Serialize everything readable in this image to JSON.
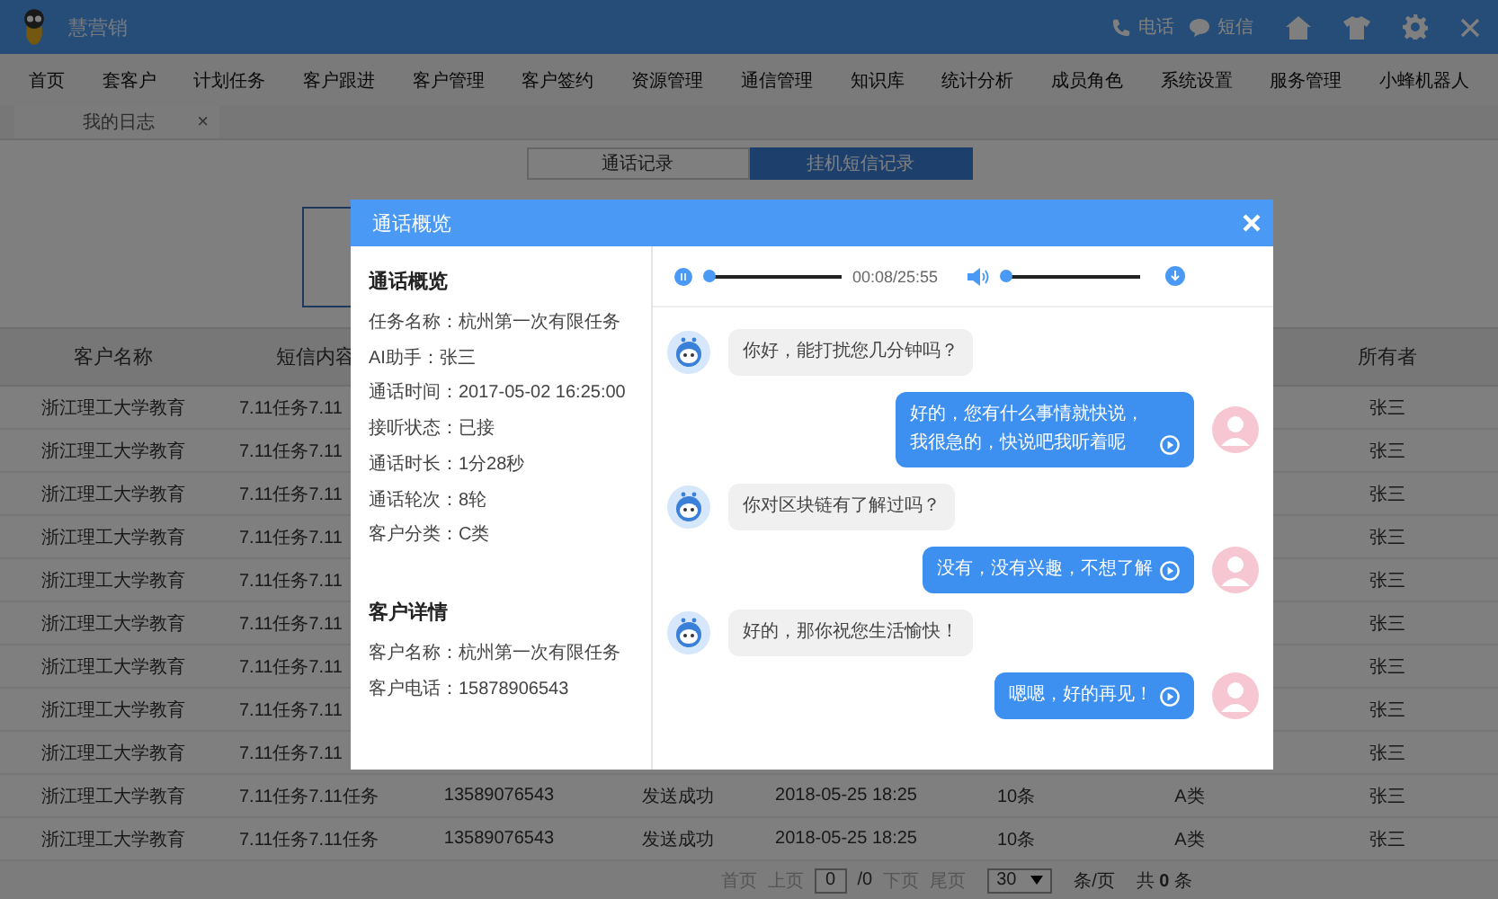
{
  "app": {
    "title": "慧营销",
    "actions": [
      {
        "kind": "phone",
        "label": "电话"
      },
      {
        "kind": "sms",
        "label": "短信"
      }
    ]
  },
  "nav": {
    "items": [
      "首页",
      "套客户",
      "计划任务",
      "客户跟进",
      "客户管理",
      "客户签约",
      "资源管理",
      "通信管理",
      "知识库",
      "统计分析",
      "成员角色",
      "系统设置",
      "服务管理",
      "小蜂机器人"
    ]
  },
  "page_tabs": [
    {
      "label": "我的日志",
      "close": "×"
    }
  ],
  "record_tabs": [
    {
      "label": "通话记录",
      "selected": false
    },
    {
      "label": "挂机短信记录",
      "selected": true
    }
  ],
  "table": {
    "columns": [
      "客户名称",
      "短信内容",
      null,
      null,
      null,
      null,
      null,
      "所有者"
    ],
    "rows": [
      {
        "cells": [
          "浙江理工大学教育",
          "7.11任务7.11",
          null,
          null,
          null,
          null,
          null,
          "张三"
        ]
      },
      {
        "cells": [
          "浙江理工大学教育",
          "7.11任务7.11",
          null,
          null,
          null,
          null,
          null,
          "张三"
        ]
      },
      {
        "cells": [
          "浙江理工大学教育",
          "7.11任务7.11",
          null,
          null,
          null,
          null,
          null,
          "张三"
        ]
      },
      {
        "cells": [
          "浙江理工大学教育",
          "7.11任务7.11",
          null,
          null,
          null,
          null,
          null,
          "张三"
        ]
      },
      {
        "cells": [
          "浙江理工大学教育",
          "7.11任务7.11",
          null,
          null,
          null,
          null,
          null,
          "张三"
        ]
      },
      {
        "cells": [
          "浙江理工大学教育",
          "7.11任务7.11",
          null,
          null,
          null,
          null,
          null,
          "张三"
        ]
      },
      {
        "cells": [
          "浙江理工大学教育",
          "7.11任务7.11",
          null,
          null,
          null,
          null,
          null,
          "张三"
        ]
      },
      {
        "cells": [
          "浙江理工大学教育",
          "7.11任务7.11",
          null,
          null,
          null,
          null,
          null,
          "张三"
        ]
      },
      {
        "cells": [
          "浙江理工大学教育",
          "7.11任务7.11",
          null,
          null,
          null,
          null,
          null,
          "张三"
        ]
      },
      {
        "cells": [
          "浙江理工大学教育",
          "7.11任务7.11任务",
          "13589076543",
          "发送成功",
          "2018-05-25 18:25",
          "10条",
          "A类",
          "张三"
        ]
      },
      {
        "cells": [
          "浙江理工大学教育",
          "7.11任务7.11任务",
          "13589076543",
          "发送成功",
          "2018-05-25 18:25",
          "10条",
          "A类",
          "张三"
        ]
      }
    ]
  },
  "pagination": {
    "first": "首页",
    "prev": "上页",
    "page": "0",
    "total_pages": "/0",
    "next": "下页",
    "last": "尾页",
    "page_size": "30",
    "per_page": "条/页",
    "total": "共 **0** 条"
  },
  "modal": {
    "title": "通话概览",
    "summary": {
      "heading": "通话概览",
      "fields": [
        "任务名称：杭州第一次有限任务",
        "AI助手：张三",
        "通话时间：2017-05-02 16:25:00",
        "接听状态：已接",
        "通话时长：1分28秒",
        "通话轮次：8轮",
        "客户分类：C类"
      ]
    },
    "customer": {
      "heading": "客户详情",
      "fields": [
        "客户名称：杭州第一次有限任务",
        "客户电话：15878906543"
      ]
    },
    "player": {
      "progress": {
        "level": 0.02
      },
      "time": "00:08/25:55",
      "volume": {
        "level": 0.02
      }
    },
    "messages": [
      {
        "kind": "bot",
        "text": "你好，能打扰您几分钟吗？"
      },
      {
        "kind": "user",
        "text": "好的，您有什么事情就快说，我很急的，快说吧我听着呢"
      },
      {
        "kind": "bot",
        "text": "你对区块链有了解过吗？"
      },
      {
        "kind": "user",
        "text": "没有，没有兴趣，不想了解"
      },
      {
        "kind": "bot",
        "text": "好的，那你祝您生活愉快！"
      },
      {
        "kind": "user",
        "text": "嗯嗯，好的再见！"
      }
    ]
  }
}
